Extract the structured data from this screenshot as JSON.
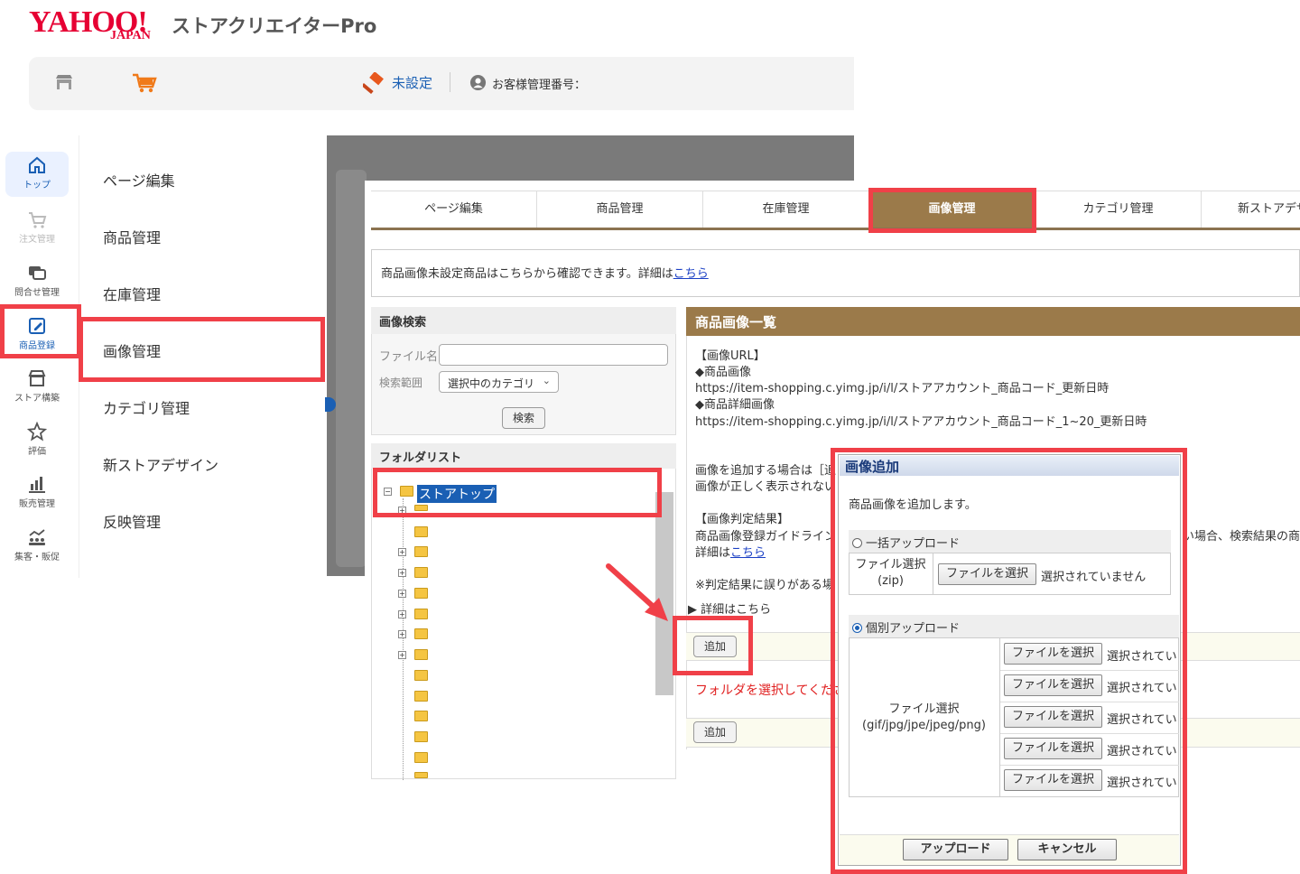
{
  "header": {
    "logo_main": "YAHOO!",
    "logo_sub": "JAPAN",
    "product": "ストアクリエイターPro",
    "unset_label": "未設定",
    "customer_label": "お客様管理番号："
  },
  "leftnav": {
    "items": [
      {
        "label": "トップ",
        "icon": "home-icon"
      },
      {
        "label": "注文管理",
        "icon": "cart-icon"
      },
      {
        "label": "問合せ管理",
        "icon": "chat-icon"
      },
      {
        "label": "商品登録",
        "icon": "edit-icon"
      },
      {
        "label": "ストア構築",
        "icon": "store-icon"
      },
      {
        "label": "評価",
        "icon": "star-icon"
      },
      {
        "label": "販売管理",
        "icon": "bar-chart-icon"
      },
      {
        "label": "集客・販促",
        "icon": "people-chart-icon"
      }
    ]
  },
  "submenu": {
    "items": [
      "ページ編集",
      "商品管理",
      "在庫管理",
      "画像管理",
      "カテゴリ管理",
      "新ストアデザイン",
      "反映管理"
    ]
  },
  "tabs": [
    "ページ編集",
    "商品管理",
    "在庫管理",
    "画像管理",
    "カテゴリ管理",
    "新ストアデザ"
  ],
  "notice": {
    "text": "商品画像未設定商品はこちらから確認できます。詳細は",
    "link": "こちら"
  },
  "search": {
    "title": "画像検索",
    "file_label": "ファイル名",
    "file_value": "",
    "range_label": "検索範囲",
    "range_value": "選択中のカテゴリ",
    "button": "検索"
  },
  "folders": {
    "title": "フォルダリスト",
    "root": "ストアトップ"
  },
  "image_list": {
    "title": "商品画像一覧",
    "url_heading": "【画像URL】",
    "product_image": "◆商品画像",
    "product_image_url": "https://item-shopping.c.yimg.jp/i/l/ストアアカウント_商品コード_更新日時",
    "detail_image": "◆商品詳細画像",
    "detail_image_url": "https://item-shopping.c.yimg.jp/i/l/ストアアカウント_商品コード_1~20_更新日時",
    "add_hint_1": "画像を追加する場合は［追",
    "add_hint_2": "画像が正しく表示されない",
    "judge_heading": "【画像判定結果】",
    "judge_line": "商品画像登録ガイドライン",
    "judge_line_right": "い場合、検索結果の商",
    "detail_prefix": "詳細は",
    "detail_link": "こちら",
    "mistake_note": "※判定結果に誤りがある場",
    "details_toggle": "▶ 詳細はこちら",
    "add_button": "追加",
    "folder_warning": "フォルダを選択してくださ",
    "add_button_2": "追加"
  },
  "dialog": {
    "title": "画像追加",
    "intro": "商品画像を追加します。",
    "bulk_label": "一括アップロード",
    "bulk_file_label_1": "ファイル選択",
    "bulk_file_label_2": "(zip)",
    "choose_file": "ファイルを選択",
    "no_file": "選択されていません",
    "individual_label": "個別アップロード",
    "ind_file_label_1": "ファイル選択",
    "ind_file_label_2": "(gif/jpg/jpe/jpeg/png)",
    "ind_no_file": "選択されてい",
    "upload_button": "アップロード",
    "cancel_button": "キャンセル"
  },
  "colors": {
    "accent_brown": "#9b7a4a",
    "highlight_red": "#f04048",
    "link_blue": "#1a3fc4",
    "warning_red": "#e02020"
  }
}
